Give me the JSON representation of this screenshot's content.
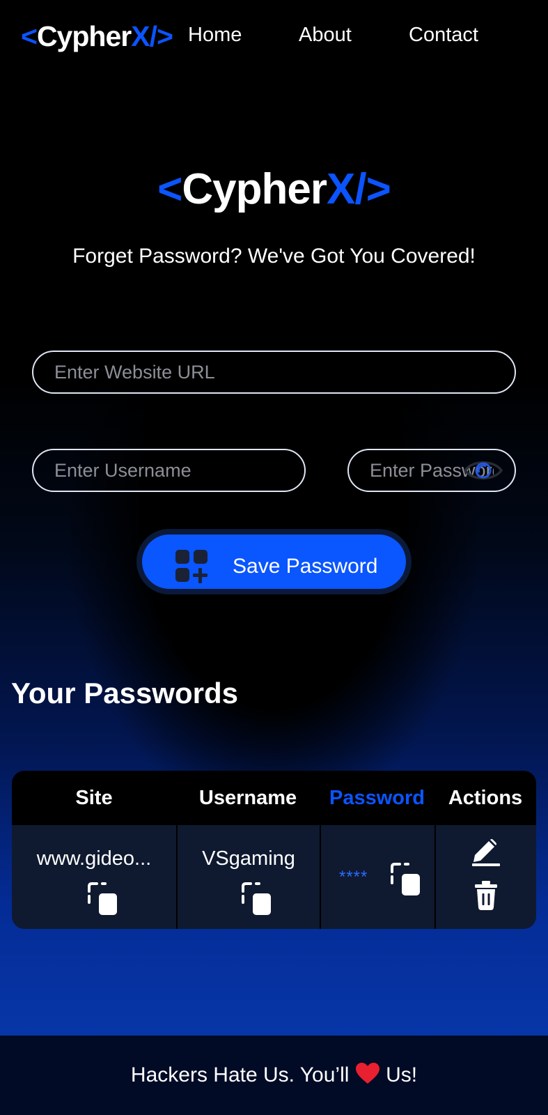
{
  "navbar": {
    "logo": {
      "open": "<",
      "name": "Cypher",
      "accent": "X/",
      "close": ">"
    },
    "links": [
      "Home",
      "About",
      "Contact"
    ]
  },
  "hero": {
    "logo": {
      "open": "<",
      "name": "Cypher",
      "accent": "X/",
      "close": ">"
    },
    "tagline": "Forget Password? We've Got You Covered!"
  },
  "form": {
    "url_placeholder": "Enter Website URL",
    "username_placeholder": "Enter Username",
    "password_placeholder": "Enter Password",
    "save_label": "Save Password"
  },
  "passwords": {
    "title": "Your Passwords",
    "columns": [
      "Site",
      "Username",
      "Password",
      "Actions"
    ],
    "rows": [
      {
        "site": "www.gideo...",
        "username": "VSgaming",
        "password": "****"
      }
    ]
  },
  "footer": {
    "text_before": "Hackers Hate Us. You’ll ",
    "heart": "❤️",
    "text_after": " Us!"
  },
  "colors": {
    "accent": "#0b54ff",
    "button": "#0a56ff",
    "background": "#000000",
    "heart": "#e8202f"
  },
  "icons": {
    "eye": "eye-icon",
    "save": "add-grid-icon",
    "copy": "copy-icon",
    "edit": "pencil-icon",
    "delete": "trash-icon",
    "heart": "heart-icon"
  }
}
